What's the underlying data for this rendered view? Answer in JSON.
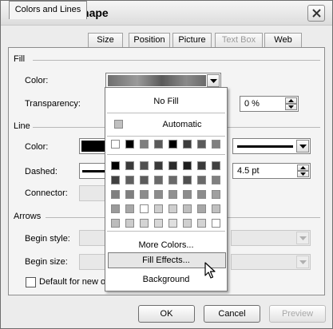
{
  "window": {
    "title": "Format AutoShape"
  },
  "tabs": [
    {
      "label": "Colors and Lines",
      "state": "active"
    },
    {
      "label": "Size",
      "state": "normal"
    },
    {
      "label": "Picture",
      "state": "normal",
      "slot": 3
    },
    {
      "label": "Position",
      "state": "normal"
    },
    {
      "label": "Text Box",
      "state": "disabled"
    },
    {
      "label": "Web",
      "state": "normal"
    }
  ],
  "fill": {
    "section": "Fill",
    "color_label": "Color:",
    "transparency_label": "Transparency:",
    "transparency_value": "0 %"
  },
  "line": {
    "section": "Line",
    "color_label": "Color:",
    "dashed_label": "Dashed:",
    "connector_label": "Connector:",
    "weight_value": "4.5 pt"
  },
  "arrows": {
    "section": "Arrows",
    "begin_style_label": "Begin style:",
    "begin_size_label": "Begin size:"
  },
  "default_checkbox_label": "Default for new ob",
  "buttons": {
    "ok": "OK",
    "cancel": "Cancel",
    "preview": "Preview"
  },
  "palette": {
    "no_fill": "No Fill",
    "automatic": "Automatic",
    "more_colors": "More Colors...",
    "fill_effects": "Fill Effects...",
    "background": "Background",
    "row1": [
      "#ffffff",
      "#000000",
      "#7f7f7f",
      "#5a5a5a",
      "#000000",
      "#3c3c3c",
      "#5a5a5a",
      "#7f7f7f"
    ],
    "grid": [
      [
        "#000000",
        "#3a3a3a",
        "#505050",
        "#3a3a3a",
        "#2a2a2a",
        "#1e1e1e",
        "#3a3a3a",
        "#404040"
      ],
      [
        "#404040",
        "#606060",
        "#5c5c5c",
        "#6a6a6a",
        "#6a6a6a",
        "#505050",
        "#6a6a6a",
        "#808080"
      ],
      [
        "#7f7f7f",
        "#7f7f7f",
        "#8c8c8c",
        "#8c8c8c",
        "#909090",
        "#8c8c8c",
        "#8c8c8c",
        "#a0a0a0"
      ],
      [
        "#9a9a9a",
        "#a8a8a8",
        "#ffffff",
        "#cfcfcf",
        "#cfcfcf",
        "#bfbfbf",
        "#a8a8a8",
        "#c0c0c0"
      ],
      [
        "#bcbcbc",
        "#cccccc",
        "#d4d4d4",
        "#d8d8d8",
        "#e0e0e0",
        "#d0d0d0",
        "#d4d4d4",
        "#ffffff"
      ]
    ]
  }
}
